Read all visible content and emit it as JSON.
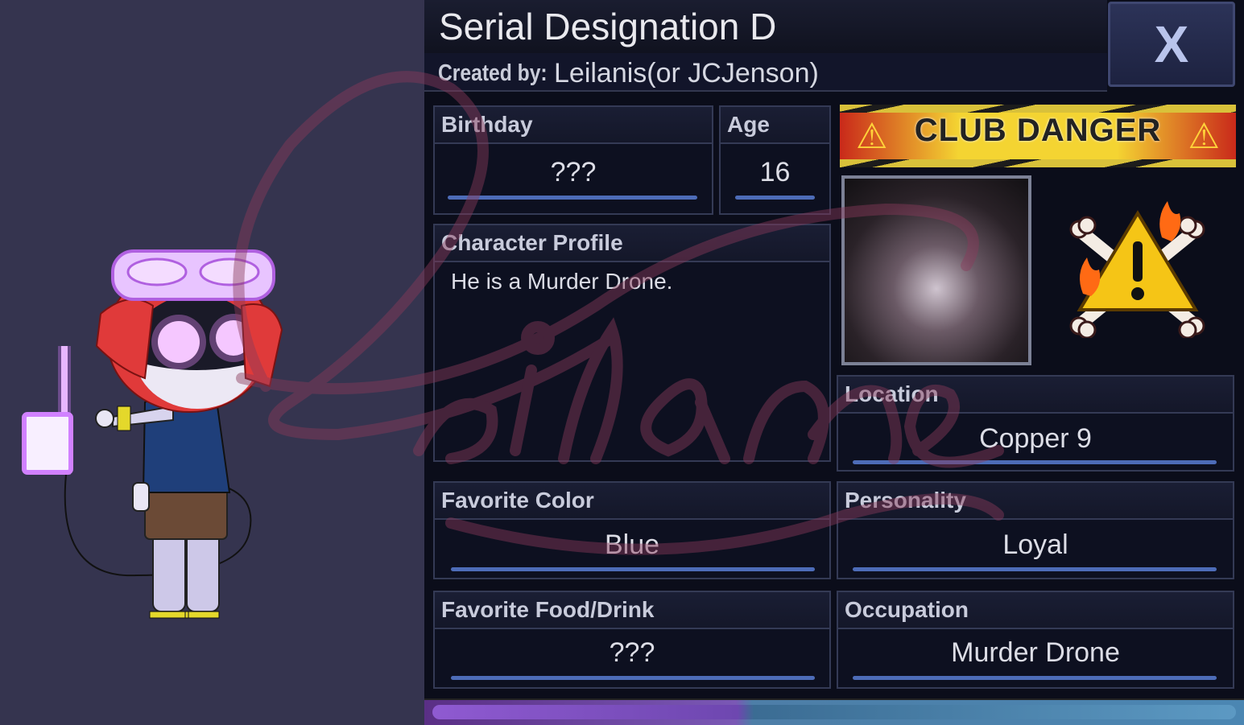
{
  "profile": {
    "title": "Serial Designation D",
    "created_by_label": "Created by:",
    "created_by_value": "Leilanis(or JCJenson)",
    "close_label": "X"
  },
  "fields": {
    "birthday": {
      "label": "Birthday",
      "value": "???"
    },
    "age": {
      "label": "Age",
      "value": "16"
    },
    "character_profile": {
      "label": "Character Profile",
      "value": "He is a Murder Drone."
    },
    "location": {
      "label": "Location",
      "value": "Copper 9"
    },
    "favorite_color": {
      "label": "Favorite Color",
      "value": "Blue"
    },
    "personality": {
      "label": "Personality",
      "value": "Loyal"
    },
    "favorite_food": {
      "label": "Favorite Food/Drink",
      "value": "???"
    },
    "occupation": {
      "label": "Occupation",
      "value": "Murder Drone"
    }
  },
  "club": {
    "banner_text": "CLUB DANGER",
    "banner_icon": "warning-icon",
    "emblem_icon": "skull-crossbones-warning-icon"
  },
  "watermark": "Leilanis",
  "colors": {
    "underline": "#4d6cb8",
    "hair": "#e03a3a",
    "eyes": "#f0a8ff"
  }
}
